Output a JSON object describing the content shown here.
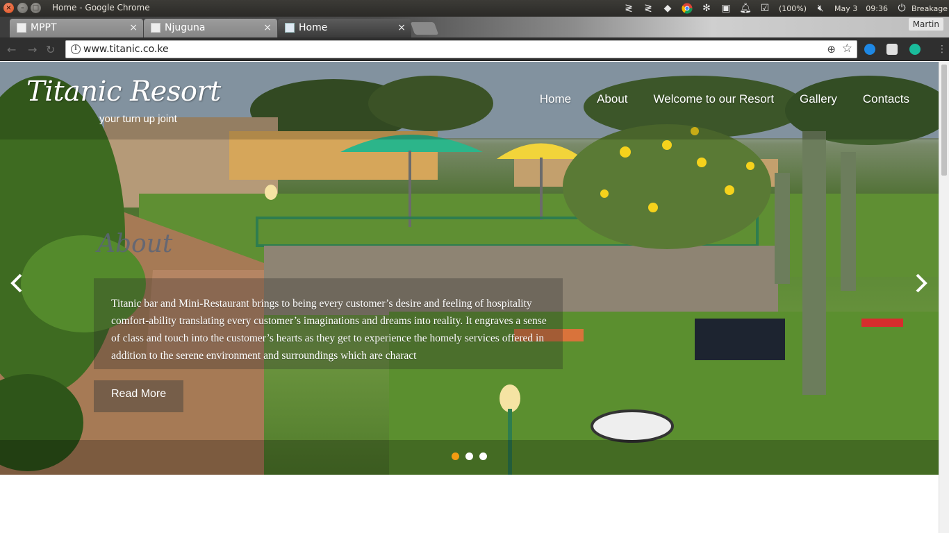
{
  "window": {
    "title": "Home - Google Chrome"
  },
  "tray": {
    "battery": "(100%)",
    "date": "May 3",
    "time": "09:36",
    "session": "Breakage"
  },
  "tabs": [
    {
      "label": "MPPT",
      "close": "×"
    },
    {
      "label": "Njuguna",
      "close": "×"
    },
    {
      "label": "Home",
      "close": "×"
    }
  ],
  "profile": "Martin",
  "toolbar": {
    "url": "www.titanic.co.ke",
    "back": "←",
    "forward": "→",
    "reload": "↻"
  },
  "site": {
    "logo": "Titanic Resort",
    "tagline": "your turn up joint",
    "nav": [
      "Home",
      "About",
      "Welcome to our Resort",
      "Gallery",
      "Contacts"
    ],
    "section_heading": "About",
    "about_text": "Titanic bar and Mini-Restaurant brings to being every customer’s desire and feeling of hospitality comfort-ability translating every customer’s imaginations and dreams into reality. It engraves a sense of class and touch into the customer’s hearts as they get to experience the homely services offered in addition to the serene environment and surroundings which are charact",
    "read_more": "Read More",
    "carousel": {
      "slides": 3,
      "active_index": 0,
      "active_color": "#f39c12"
    }
  }
}
